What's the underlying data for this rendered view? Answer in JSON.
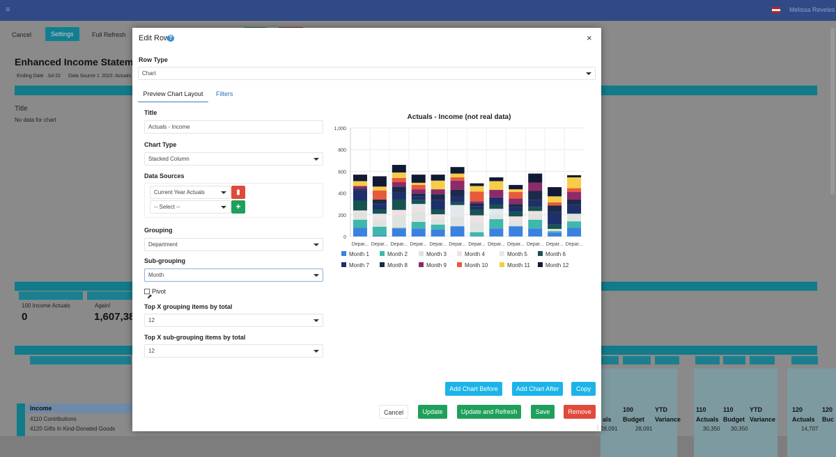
{
  "topbar": {
    "user": "Melissa Reveles"
  },
  "bg": {
    "buttons": {
      "cancel": "Cancel",
      "settings": "Settings",
      "full_refresh": "Full Refresh"
    },
    "page_title": "Enhanced Income Stateme",
    "filters": {
      "ending_date_label": "Ending Date",
      "ending_date": "Jul-22",
      "data_source_label": "Data Source 1",
      "data_source": "2022: Actuals"
    },
    "title_label": "Title",
    "no_data": "No data for chart",
    "kpi1_label": "100 Income Actuals",
    "kpi1_value": "0",
    "kpi2_label": "Again!",
    "kpi2_value": "1,607,38",
    "headers": [
      {
        "l1": "als",
        "l2": ""
      },
      {
        "l1": "100",
        "l2": "Budget"
      },
      {
        "l1": "YTD",
        "l2": "Variance"
      },
      {
        "l1": "110",
        "l2": "Actuals"
      },
      {
        "l1": "110",
        "l2": "Budget"
      },
      {
        "l1": "YTD",
        "l2": "Variance"
      },
      {
        "l1": "120",
        "l2": "Actuals"
      },
      {
        "l1": "120",
        "l2": "Buc"
      }
    ],
    "rows": {
      "income": "Income",
      "r1": "4110 Contributions",
      "r2": "4120 Gifts In Kind-Donated Goods"
    },
    "row_values": {
      "v1": "28,091",
      "v2": "28,091",
      "v3": "30,350",
      "v4": "30,350",
      "v5": "14,707"
    }
  },
  "modal": {
    "title": "Edit Row",
    "help_icon": "?",
    "row_type_label": "Row Type",
    "row_type": "Chart",
    "tabs": {
      "preview": "Preview Chart Layout",
      "filters": "Filters"
    },
    "title_label": "Title",
    "title_value": "Actuals - Income",
    "chart_type_label": "Chart Type",
    "chart_type": "Stacked Column",
    "data_sources_label": "Data Sources",
    "data_source_1": "Current Year Actuals",
    "data_source_2": "-- Select --",
    "grouping_label": "Grouping",
    "grouping": "Department",
    "subgrouping_label": "Sub-grouping",
    "subgrouping": "Month",
    "pivot_label": "Pivot",
    "top_x_label": "Top X grouping items by total",
    "top_x": "12",
    "top_x_sub_label": "Top X sub-grouping items by total",
    "top_x_sub": "12",
    "buttons": {
      "add_before": "Add Chart Before",
      "add_after": "Add Chart After",
      "copy": "Copy",
      "cancel": "Cancel",
      "update": "Update",
      "update_refresh": "Update and Refresh",
      "save": "Save",
      "remove": "Remove"
    }
  },
  "chart_data": {
    "type": "bar",
    "stacked": true,
    "title": "Actuals - Income (not real data)",
    "ylim": [
      0,
      1000
    ],
    "yticks": [
      "0",
      "200",
      "400",
      "600",
      "800",
      "1,000"
    ],
    "categories": [
      "Depar...",
      "Depar...",
      "Depar...",
      "Depar...",
      "Depar...",
      "Depar...",
      "Depar...",
      "Depar...",
      "Depar...",
      "Depar...",
      "Depar...",
      "Depar..."
    ],
    "series": [
      {
        "name": "Month 1",
        "color": "#3b82e0",
        "values": [
          80,
          10,
          75,
          75,
          65,
          95,
          5,
          75,
          95,
          75,
          35,
          80
        ]
      },
      {
        "name": "Month 2",
        "color": "#3fb8ac",
        "values": [
          75,
          80,
          5,
          60,
          45,
          0,
          35,
          85,
          0,
          80,
          15,
          60
        ]
      },
      {
        "name": "Month 3",
        "color": "#dfe3df",
        "values": [
          70,
          60,
          120,
          95,
          55,
          90,
          95,
          45,
          50,
          50,
          20,
          70
        ]
      },
      {
        "name": "Month 4",
        "color": "#f0e0e4",
        "values": [
          15,
          30,
          45,
          40,
          40,
          0,
          60,
          0,
          40,
          30,
          0,
          0
        ]
      },
      {
        "name": "Month 5",
        "color": "#e3e8ee",
        "values": [
          0,
          30,
          0,
          30,
          0,
          105,
          0,
          50,
          0,
          0,
          0,
          0
        ]
      },
      {
        "name": "Month 6",
        "color": "#17534f",
        "values": [
          90,
          40,
          95,
          35,
          45,
          25,
          55,
          40,
          45,
          40,
          40,
          0
        ]
      },
      {
        "name": "Month 7",
        "color": "#1e2f6b",
        "values": [
          95,
          50,
          70,
          35,
          85,
          60,
          30,
          65,
          40,
          60,
          115,
          80
        ]
      },
      {
        "name": "Month 8",
        "color": "#1a2a48",
        "values": [
          15,
          40,
          50,
          25,
          55,
          55,
          25,
          0,
          30,
          85,
          60,
          50
        ]
      },
      {
        "name": "Month 9",
        "color": "#8c2a6a",
        "values": [
          25,
          0,
          40,
          40,
          45,
          85,
          20,
          70,
          50,
          75,
          0,
          70
        ]
      },
      {
        "name": "Month 10",
        "color": "#e85a3c",
        "values": [
          0,
          85,
          40,
          40,
          0,
          30,
          90,
          0,
          60,
          0,
          30,
          35
        ]
      },
      {
        "name": "Month 11",
        "color": "#f6cc48",
        "values": [
          45,
          35,
          50,
          20,
          80,
          35,
          50,
          80,
          25,
          0,
          55,
          100
        ]
      },
      {
        "name": "Month 12",
        "color": "#111a35",
        "values": [
          60,
          95,
          70,
          75,
          55,
          60,
          25,
          35,
          40,
          85,
          85,
          20
        ]
      }
    ]
  }
}
